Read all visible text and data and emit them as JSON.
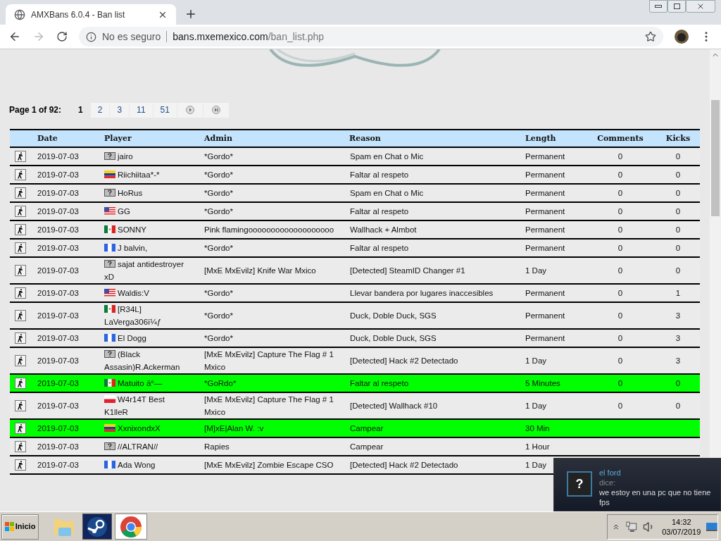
{
  "browser": {
    "tab_title": "AMXBans 6.0.4 - Ban list",
    "security": "No es seguro",
    "url_host": "bans.mxemexico.com",
    "url_path": "/ban_list.php"
  },
  "pagination": {
    "label": "Page 1 of 92:",
    "pages": [
      {
        "label": "1",
        "selected": true
      },
      {
        "label": "2",
        "selected": false
      },
      {
        "label": "3",
        "selected": false
      },
      {
        "label": "11",
        "selected": false
      },
      {
        "label": "51",
        "selected": false
      }
    ]
  },
  "table": {
    "columns": [
      "Date",
      "Player",
      "Admin",
      "Reason",
      "Length",
      "Comments",
      "Kicks"
    ],
    "rows": [
      {
        "date": "2019-07-03",
        "flag": {
          "kind": "unknown"
        },
        "player": "jairo",
        "admin": "*Gordo*",
        "reason": "Spam en Chat o Mic",
        "length": "Permanent",
        "comments": "0",
        "kicks": "0",
        "highlighted": false
      },
      {
        "date": "2019-07-03",
        "flag": {
          "kind": "ve"
        },
        "player": "Riichiitaa*-*",
        "admin": "*Gordo*",
        "reason": "Faltar al respeto",
        "length": "Permanent",
        "comments": "0",
        "kicks": "0",
        "highlighted": false
      },
      {
        "date": "2019-07-03",
        "flag": {
          "kind": "unknown"
        },
        "player": "HoRus",
        "admin": "*Gordo*",
        "reason": "Spam en Chat o Mic",
        "length": "Permanent",
        "comments": "0",
        "kicks": "0",
        "highlighted": false
      },
      {
        "date": "2019-07-03",
        "flag": {
          "kind": "us"
        },
        "player": "GG",
        "admin": "*Gordo*",
        "reason": "Faltar al respeto",
        "length": "Permanent",
        "comments": "0",
        "kicks": "0",
        "highlighted": false
      },
      {
        "date": "2019-07-03",
        "flag": {
          "kind": "mx"
        },
        "player": "SONNY",
        "admin": "Pink flamingooooooooooooooooooo",
        "reason": "Wallhack + Almbot",
        "length": "Permanent",
        "comments": "0",
        "kicks": "0",
        "highlighted": false
      },
      {
        "date": "2019-07-03",
        "flag": {
          "kind": "gt"
        },
        "player": "J balvin,",
        "admin": "*Gordo*",
        "reason": "Faltar al respeto",
        "length": "Permanent",
        "comments": "0",
        "kicks": "0",
        "highlighted": false
      },
      {
        "date": "2019-07-03",
        "flag": {
          "kind": "unknown"
        },
        "player": "sajat antidestroyer xD",
        "admin": "[MxE MxEvilz] Knife War Mxico",
        "reason": "[Detected] SteamID Changer #1",
        "length": "1 Day",
        "comments": "0",
        "kicks": "0",
        "highlighted": false
      },
      {
        "date": "2019-07-03",
        "flag": {
          "kind": "us"
        },
        "player": "Waldis:V",
        "admin": "*Gordo*",
        "reason": "Llevar bandera por lugares inaccesibles",
        "length": "Permanent",
        "comments": "0",
        "kicks": "1",
        "highlighted": false
      },
      {
        "date": "2019-07-03",
        "flag": {
          "kind": "mx"
        },
        "player": "[R34L] LaVerga306ï¼ƒ",
        "admin": "*Gordo*",
        "reason": "Duck, Doble Duck, SGS",
        "length": "Permanent",
        "comments": "0",
        "kicks": "3",
        "highlighted": false
      },
      {
        "date": "2019-07-03",
        "flag": {
          "kind": "gt"
        },
        "player": "El Dogg",
        "admin": "*Gordo*",
        "reason": "Duck, Doble Duck, SGS",
        "length": "Permanent",
        "comments": "0",
        "kicks": "3",
        "highlighted": false
      },
      {
        "date": "2019-07-03",
        "flag": {
          "kind": "unknown"
        },
        "player": "(Black Assasin)R.Ackerman",
        "admin": "[MxE MxEvilz] Capture The Flag # 1 Mxico",
        "reason": "[Detected] Hack #2 Detectado",
        "length": "1 Day",
        "comments": "0",
        "kicks": "3",
        "highlighted": false
      },
      {
        "date": "2019-07-03",
        "flag": {
          "kind": "mx"
        },
        "player": "Matuito ä°—",
        "admin": "*GoRdo*",
        "reason": "Faltar al respeto",
        "length": "5 Minutes",
        "comments": "0",
        "kicks": "0",
        "highlighted": true
      },
      {
        "date": "2019-07-03",
        "flag": {
          "kind": "pl"
        },
        "player": "W4r14T Best K1lleR",
        "admin": "[MxE MxEvilz] Capture The Flag # 1 Mxico",
        "reason": "[Detected] Wallhack #10",
        "length": "1 Day",
        "comments": "0",
        "kicks": "0",
        "highlighted": false
      },
      {
        "date": "2019-07-03",
        "flag": {
          "kind": "ve"
        },
        "player": "XxnixondxX",
        "admin": "[M]xE|Alan W. :v",
        "reason": "Campear",
        "length": "30 Min",
        "highlighted": true
      },
      {
        "date": "2019-07-03",
        "flag": {
          "kind": "unknown"
        },
        "player": "//ALTRAN//",
        "admin": "Rapies",
        "reason": "Campear",
        "length": "1 Hour",
        "highlighted": false
      },
      {
        "date": "2019-07-03",
        "flag": {
          "kind": "gt"
        },
        "player": "Ada Wong",
        "admin": "[MxE MxEvilz] Zombie Escape CSO",
        "reason": "[Detected] Hack #2 Detectado",
        "length": "1 Day",
        "highlighted": false
      }
    ]
  },
  "notification": {
    "avatar": "?",
    "sender": "el ford",
    "verb": "dice:",
    "message": "we estoy en una pc que no tiene fps"
  },
  "taskbar": {
    "start": "Inicio",
    "time": "14:32",
    "date": "03/07/2019"
  }
}
